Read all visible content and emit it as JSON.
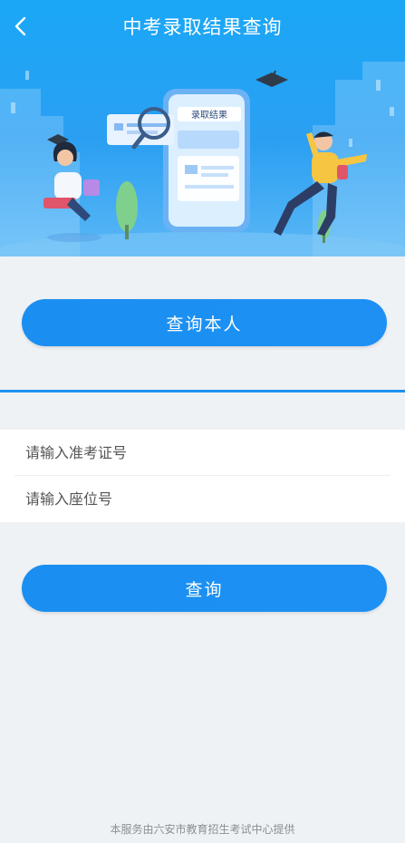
{
  "header": {
    "title": "中考录取结果查询",
    "back_icon": "chevron-left-icon"
  },
  "illustration": {
    "card_label": "录取结果"
  },
  "buttons": {
    "query_self": "查询本人",
    "query": "查询"
  },
  "form": {
    "exam_id_placeholder": "请输入准考证号",
    "seat_no_placeholder": "请输入座位号"
  },
  "footer": {
    "text": "本服务由六安市教育招生考试中心提供"
  },
  "colors": {
    "primary": "#1e90f4",
    "header_bg": "#1aa7f6",
    "page_bg": "#eff2f4"
  }
}
